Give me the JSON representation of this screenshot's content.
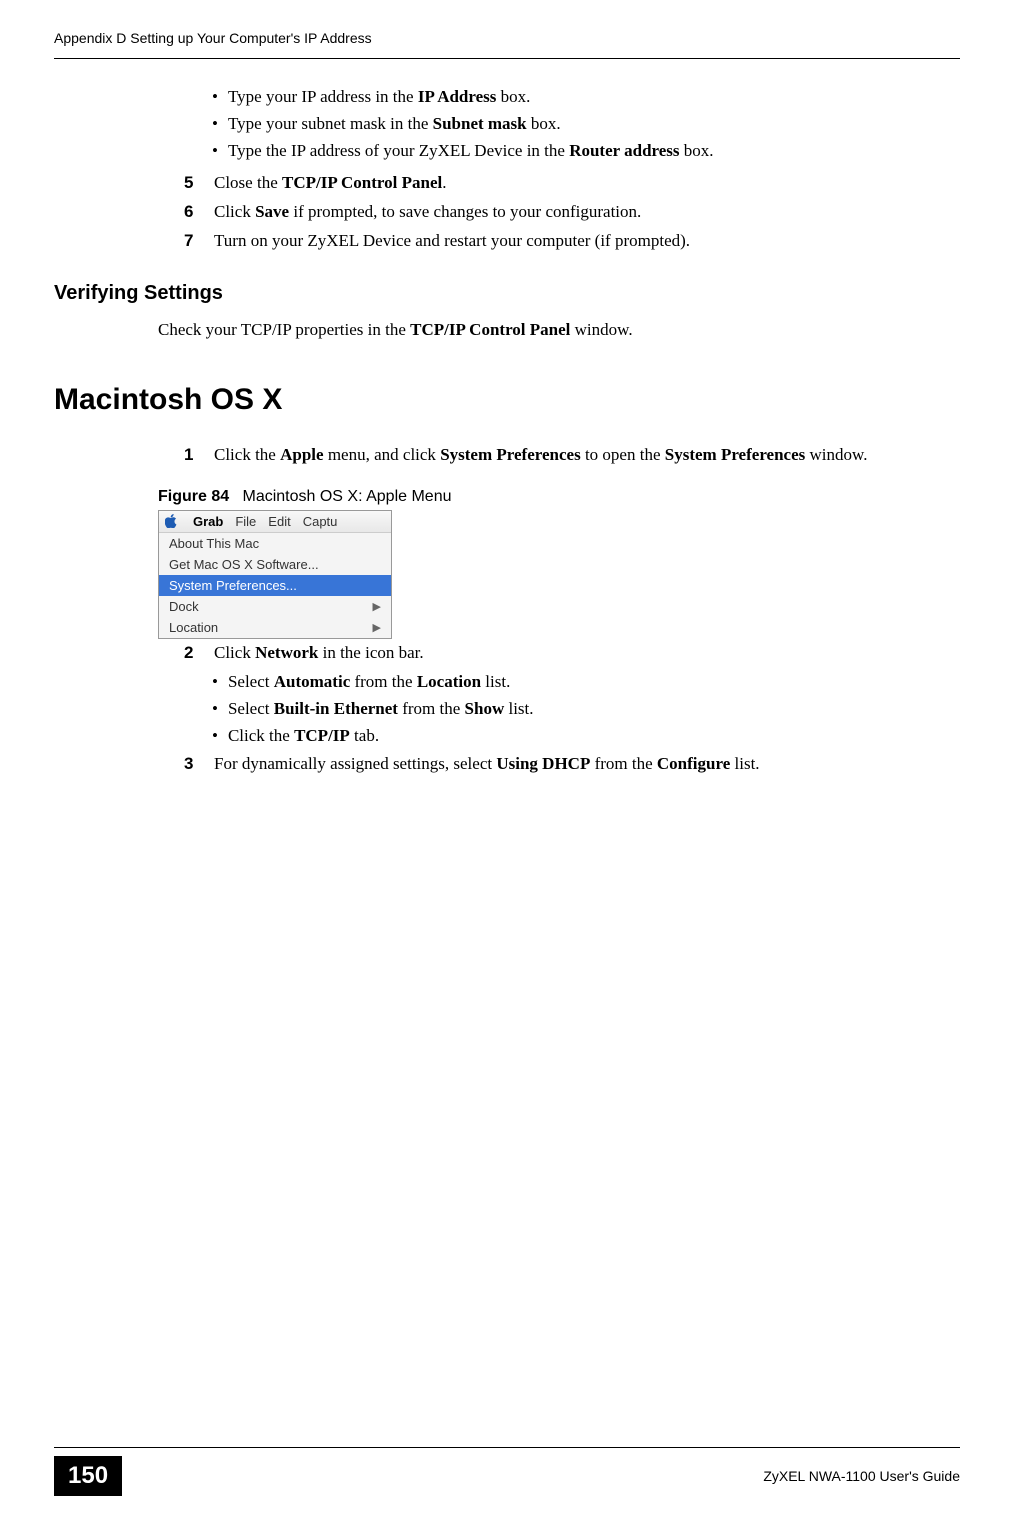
{
  "header": {
    "text": "Appendix D Setting up Your Computer's IP Address"
  },
  "bullets_top": [
    {
      "prefix": "•",
      "text_before": "Type your IP address in the ",
      "bold": "IP Address",
      "text_after": " box."
    },
    {
      "prefix": "•",
      "text_before": "Type your subnet mask in the ",
      "bold": "Subnet mask",
      "text_after": " box."
    },
    {
      "prefix": "•",
      "text_before": "Type the IP address of your ZyXEL Device in the ",
      "bold": "Router address",
      "text_after": " box."
    }
  ],
  "steps_top": [
    {
      "num": "5",
      "text_before": "Close the ",
      "bold": "TCP/IP Control Panel",
      "text_after": "."
    },
    {
      "num": "6",
      "text_before": "Click ",
      "bold": "Save",
      "text_after": " if prompted, to save changes to your configuration."
    },
    {
      "num": "7",
      "text_before": "Turn on your ZyXEL Device and restart your computer (if prompted).",
      "bold": "",
      "text_after": ""
    }
  ],
  "verifying": {
    "heading": "Verifying Settings",
    "text_before": "Check your TCP/IP properties in the ",
    "bold": "TCP/IP Control Panel",
    "text_after": " window."
  },
  "macintosh": {
    "heading": "Macintosh OS X",
    "step1": {
      "num": "1",
      "part1": "Click the ",
      "bold1": "Apple",
      "part2": " menu, and click ",
      "bold2": "System Preferences",
      "part3": " to open the ",
      "bold3": "System Preferences",
      "part4": " window."
    }
  },
  "figure": {
    "label": "Figure 84",
    "caption": "Macintosh OS X: Apple Menu"
  },
  "apple_menu": {
    "menubar": [
      "Grab",
      "File",
      "Edit",
      "Captu"
    ],
    "items": [
      {
        "label": "About This Mac",
        "submenu": false,
        "selected": false
      },
      {
        "label": "Get Mac OS X Software...",
        "submenu": false,
        "selected": false
      },
      {
        "label": "System Preferences...",
        "submenu": false,
        "selected": true
      },
      {
        "label": "Dock",
        "submenu": true,
        "selected": false
      },
      {
        "label": "Location",
        "submenu": true,
        "selected": false
      }
    ]
  },
  "step2": {
    "num": "2",
    "text_before": "Click ",
    "bold": "Network",
    "text_after": " in the icon bar."
  },
  "sub_bullets": [
    {
      "prefix": "•",
      "part1": "Select ",
      "bold1": "Automatic",
      "part2": " from the ",
      "bold2": "Location",
      "part3": " list."
    },
    {
      "prefix": "•",
      "part1": "Select ",
      "bold1": "Built-in Ethernet",
      "part2": " from the ",
      "bold2": "Show",
      "part3": " list."
    },
    {
      "prefix": "•",
      "part1": "Click the ",
      "bold1": "TCP/IP",
      "part2": " tab.",
      "bold2": "",
      "part3": ""
    }
  ],
  "step3": {
    "num": "3",
    "part1": "For dynamically assigned settings, select ",
    "bold1": "Using DHCP",
    "part2": " from the ",
    "bold2": "Configure",
    "part3": " list."
  },
  "footer": {
    "page": "150",
    "text": "ZyXEL NWA-1100 User's Guide"
  }
}
